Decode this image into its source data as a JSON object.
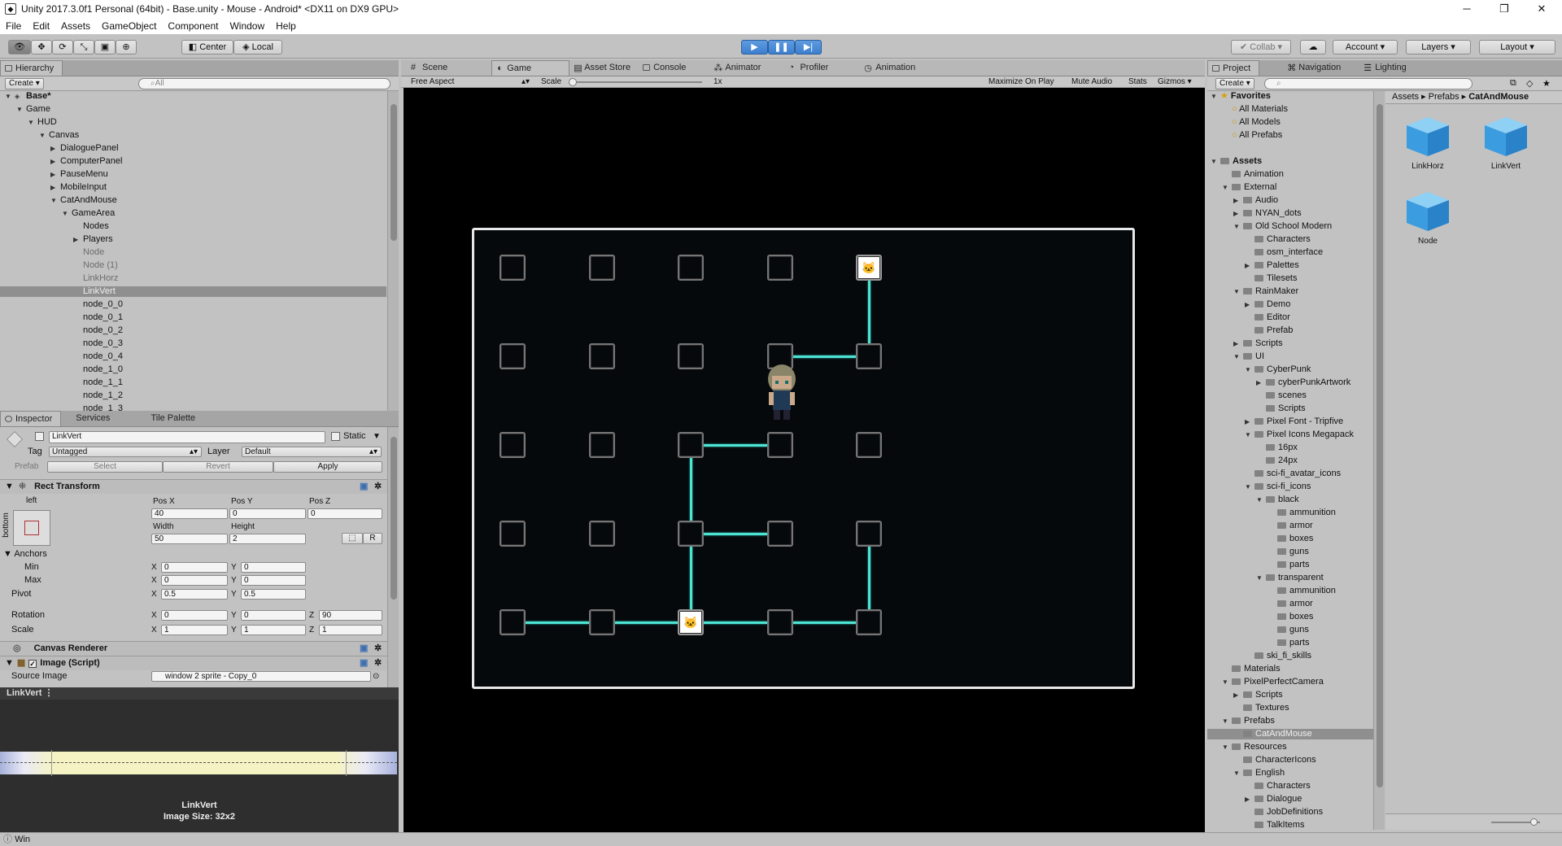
{
  "window": {
    "title": "Unity 2017.3.0f1 Personal (64bit) - Base.unity - Mouse - Android* <DX11 on DX9 GPU>",
    "minimize": "─",
    "restore": "❐",
    "close": "✕"
  },
  "menu": [
    "File",
    "Edit",
    "Assets",
    "GameObject",
    "Component",
    "Window",
    "Help"
  ],
  "toolbar": {
    "center": "Center",
    "local": "Local",
    "collab": "Collab",
    "account": "Account",
    "layers": "Layers",
    "layout": "Layout"
  },
  "hierarchy": {
    "tab": "Hierarchy",
    "create": "Create",
    "search_placeholder": "All",
    "items": [
      {
        "label": "Base*",
        "depth": 0,
        "arrow": "▼"
      },
      {
        "label": "Game",
        "depth": 1,
        "arrow": "▼"
      },
      {
        "label": "HUD",
        "depth": 2,
        "arrow": "▼"
      },
      {
        "label": "Canvas",
        "depth": 3,
        "arrow": "▼"
      },
      {
        "label": "DialoguePanel",
        "depth": 4,
        "arrow": "▶"
      },
      {
        "label": "ComputerPanel",
        "depth": 4,
        "arrow": "▶"
      },
      {
        "label": "PauseMenu",
        "depth": 4,
        "arrow": "▶"
      },
      {
        "label": "MobileInput",
        "depth": 4,
        "arrow": "▶"
      },
      {
        "label": "CatAndMouse",
        "depth": 4,
        "arrow": "▼"
      },
      {
        "label": "GameArea",
        "depth": 5,
        "arrow": "▼"
      },
      {
        "label": "Nodes",
        "depth": 6,
        "arrow": ""
      },
      {
        "label": "Players",
        "depth": 6,
        "arrow": "▶"
      },
      {
        "label": "Node",
        "depth": 6,
        "arrow": ""
      },
      {
        "label": "Node (1)",
        "depth": 6,
        "arrow": ""
      },
      {
        "label": "LinkHorz",
        "depth": 6,
        "arrow": ""
      },
      {
        "label": "LinkVert",
        "depth": 6,
        "arrow": ""
      },
      {
        "label": "node_0_0",
        "depth": 6,
        "arrow": ""
      },
      {
        "label": "node_0_1",
        "depth": 6,
        "arrow": ""
      },
      {
        "label": "node_0_2",
        "depth": 6,
        "arrow": ""
      },
      {
        "label": "node_0_3",
        "depth": 6,
        "arrow": ""
      },
      {
        "label": "node_0_4",
        "depth": 6,
        "arrow": ""
      },
      {
        "label": "node_1_0",
        "depth": 6,
        "arrow": ""
      },
      {
        "label": "node_1_1",
        "depth": 6,
        "arrow": ""
      },
      {
        "label": "node_1_2",
        "depth": 6,
        "arrow": ""
      },
      {
        "label": "node_1_3",
        "depth": 6,
        "arrow": ""
      }
    ]
  },
  "inspector": {
    "tabs": [
      "Inspector",
      "Services",
      "Tile Palette"
    ],
    "object_name": "LinkVert",
    "static": "Static",
    "tag_label": "Tag",
    "tag_value": "Untagged",
    "layer_label": "Layer",
    "layer_value": "Default",
    "prefab_label": "Prefab",
    "select": "Select",
    "revert": "Revert",
    "apply": "Apply",
    "rect_transform": "Rect Transform",
    "anchor_left": "left",
    "anchor_bottom": "bottom",
    "pos_x_label": "Pos X",
    "pos_y_label": "Pos Y",
    "pos_z_label": "Pos Z",
    "pos_x": "40",
    "pos_y": "0",
    "pos_z": "0",
    "width_label": "Width",
    "height_label": "Height",
    "width": "50",
    "height": "2",
    "r_button": "R",
    "anchors": "Anchors",
    "min": "Min",
    "max": "Max",
    "min_x": "0",
    "min_y": "0",
    "max_x": "0",
    "max_y": "0",
    "pivot": "Pivot",
    "pivot_x": "0.5",
    "pivot_y": "0.5",
    "rotation": "Rotation",
    "rot_x": "0",
    "rot_y": "0",
    "rot_z": "90",
    "scale": "Scale",
    "scale_x": "1",
    "scale_y": "1",
    "scale_z": "1",
    "x": "X",
    "y": "Y",
    "z": "Z",
    "canvas_renderer": "Canvas Renderer",
    "image_script": "Image (Script)",
    "source_image_label": "Source Image",
    "source_image": "window 2 sprite - Copy_0"
  },
  "preview": {
    "header": "LinkVert",
    "name": "LinkVert",
    "size": "Image Size: 32x2"
  },
  "center_tabs": [
    "Scene",
    "Game",
    "Asset Store",
    "Console",
    "Animator",
    "Profiler",
    "Animation"
  ],
  "game_bar": {
    "aspect": "Free Aspect",
    "scale_label": "Scale",
    "scale_value": "1x",
    "maximize": "Maximize On Play",
    "mute": "Mute Audio",
    "stats": "Stats",
    "gizmos": "Gizmos"
  },
  "game": {
    "grid_cols": 5,
    "grid_rows": 5,
    "cat_nodes": [
      "4,0",
      "2,4"
    ],
    "cat_glyph": "🐱",
    "links_h": [
      "3,1",
      "2,2",
      "2,3",
      "0,4",
      "1,4",
      "2,4",
      "3,4"
    ],
    "links_v": [
      "4,0",
      "2,2",
      "2,3",
      "4,3"
    ],
    "player_node": "3,1"
  },
  "project": {
    "tabs": [
      "Project",
      "Navigation",
      "Lighting"
    ],
    "create": "Create",
    "breadcrumb": [
      "Assets",
      "Prefabs",
      "CatAndMouse"
    ],
    "tree": [
      {
        "label": "Favorites",
        "depth": 0,
        "arrow": "▼",
        "type": "star",
        "bold": true
      },
      {
        "label": "All Materials",
        "depth": 1,
        "arrow": "",
        "type": "search"
      },
      {
        "label": "All Models",
        "depth": 1,
        "arrow": "",
        "type": "search"
      },
      {
        "label": "All Prefabs",
        "depth": 1,
        "arrow": "",
        "type": "search"
      },
      {
        "label": "",
        "depth": 0,
        "arrow": "",
        "type": "blank"
      },
      {
        "label": "Assets",
        "depth": 0,
        "arrow": "▼",
        "type": "folder",
        "bold": true
      },
      {
        "label": "Animation",
        "depth": 1,
        "arrow": "",
        "type": "folder"
      },
      {
        "label": "External",
        "depth": 1,
        "arrow": "▼",
        "type": "folder"
      },
      {
        "label": "Audio",
        "depth": 2,
        "arrow": "▶",
        "type": "folder"
      },
      {
        "label": "NYAN_dots",
        "depth": 2,
        "arrow": "▶",
        "type": "folder"
      },
      {
        "label": "Old School Modern",
        "depth": 2,
        "arrow": "▼",
        "type": "folder"
      },
      {
        "label": "Characters",
        "depth": 3,
        "arrow": "",
        "type": "folder"
      },
      {
        "label": "osm_interface",
        "depth": 3,
        "arrow": "",
        "type": "folder"
      },
      {
        "label": "Palettes",
        "depth": 3,
        "arrow": "▶",
        "type": "folder"
      },
      {
        "label": "Tilesets",
        "depth": 3,
        "arrow": "",
        "type": "folder"
      },
      {
        "label": "RainMaker",
        "depth": 2,
        "arrow": "▼",
        "type": "folder"
      },
      {
        "label": "Demo",
        "depth": 3,
        "arrow": "▶",
        "type": "folder"
      },
      {
        "label": "Editor",
        "depth": 3,
        "arrow": "",
        "type": "folder"
      },
      {
        "label": "Prefab",
        "depth": 3,
        "arrow": "",
        "type": "folder"
      },
      {
        "label": "Scripts",
        "depth": 2,
        "arrow": "▶",
        "type": "folder"
      },
      {
        "label": "UI",
        "depth": 2,
        "arrow": "▼",
        "type": "folder"
      },
      {
        "label": "CyberPunk",
        "depth": 3,
        "arrow": "▼",
        "type": "folder"
      },
      {
        "label": "cyberPunkArtwork",
        "depth": 4,
        "arrow": "▶",
        "type": "folder"
      },
      {
        "label": "scenes",
        "depth": 4,
        "arrow": "",
        "type": "folder"
      },
      {
        "label": "Scripts",
        "depth": 4,
        "arrow": "",
        "type": "folder"
      },
      {
        "label": "Pixel Font - Tripfive",
        "depth": 3,
        "arrow": "▶",
        "type": "folder"
      },
      {
        "label": "Pixel Icons Megapack",
        "depth": 3,
        "arrow": "▼",
        "type": "folder"
      },
      {
        "label": "16px",
        "depth": 4,
        "arrow": "",
        "type": "folder"
      },
      {
        "label": "24px",
        "depth": 4,
        "arrow": "",
        "type": "folder"
      },
      {
        "label": "sci-fi_avatar_icons",
        "depth": 3,
        "arrow": "",
        "type": "folder"
      },
      {
        "label": "sci-fi_icons",
        "depth": 3,
        "arrow": "▼",
        "type": "folder"
      },
      {
        "label": "black",
        "depth": 4,
        "arrow": "▼",
        "type": "folder"
      },
      {
        "label": "ammunition",
        "depth": 5,
        "arrow": "",
        "type": "folder"
      },
      {
        "label": "armor",
        "depth": 5,
        "arrow": "",
        "type": "folder"
      },
      {
        "label": "boxes",
        "depth": 5,
        "arrow": "",
        "type": "folder"
      },
      {
        "label": "guns",
        "depth": 5,
        "arrow": "",
        "type": "folder"
      },
      {
        "label": "parts",
        "depth": 5,
        "arrow": "",
        "type": "folder"
      },
      {
        "label": "transparent",
        "depth": 4,
        "arrow": "▼",
        "type": "folder"
      },
      {
        "label": "ammunition",
        "depth": 5,
        "arrow": "",
        "type": "folder"
      },
      {
        "label": "armor",
        "depth": 5,
        "arrow": "",
        "type": "folder"
      },
      {
        "label": "boxes",
        "depth": 5,
        "arrow": "",
        "type": "folder"
      },
      {
        "label": "guns",
        "depth": 5,
        "arrow": "",
        "type": "folder"
      },
      {
        "label": "parts",
        "depth": 5,
        "arrow": "",
        "type": "folder"
      },
      {
        "label": "ski_fi_skills",
        "depth": 3,
        "arrow": "",
        "type": "folder"
      },
      {
        "label": "Materials",
        "depth": 1,
        "arrow": "",
        "type": "folder"
      },
      {
        "label": "PixelPerfectCamera",
        "depth": 1,
        "arrow": "▼",
        "type": "folder"
      },
      {
        "label": "Scripts",
        "depth": 2,
        "arrow": "▶",
        "type": "folder"
      },
      {
        "label": "Textures",
        "depth": 2,
        "arrow": "",
        "type": "folder"
      },
      {
        "label": "Prefabs",
        "depth": 1,
        "arrow": "▼",
        "type": "folder"
      },
      {
        "label": "CatAndMouse",
        "depth": 2,
        "arrow": "",
        "type": "folder",
        "selected": true
      },
      {
        "label": "Resources",
        "depth": 1,
        "arrow": "▼",
        "type": "folder"
      },
      {
        "label": "CharacterIcons",
        "depth": 2,
        "arrow": "",
        "type": "folder"
      },
      {
        "label": "English",
        "depth": 2,
        "arrow": "▼",
        "type": "folder"
      },
      {
        "label": "Characters",
        "depth": 3,
        "arrow": "",
        "type": "folder"
      },
      {
        "label": "Dialogue",
        "depth": 3,
        "arrow": "▶",
        "type": "folder"
      },
      {
        "label": "JobDefinitions",
        "depth": 3,
        "arrow": "",
        "type": "folder"
      },
      {
        "label": "TalkItems",
        "depth": 3,
        "arrow": "",
        "type": "folder"
      }
    ],
    "assets": [
      "LinkHorz",
      "LinkVert",
      "Node"
    ]
  },
  "status": {
    "text": "Win"
  },
  "colors": {
    "link": "#4de3d3",
    "game_bg": "#06090c",
    "frame": "#e8e8e8",
    "play_active": "#3d7fcf"
  }
}
